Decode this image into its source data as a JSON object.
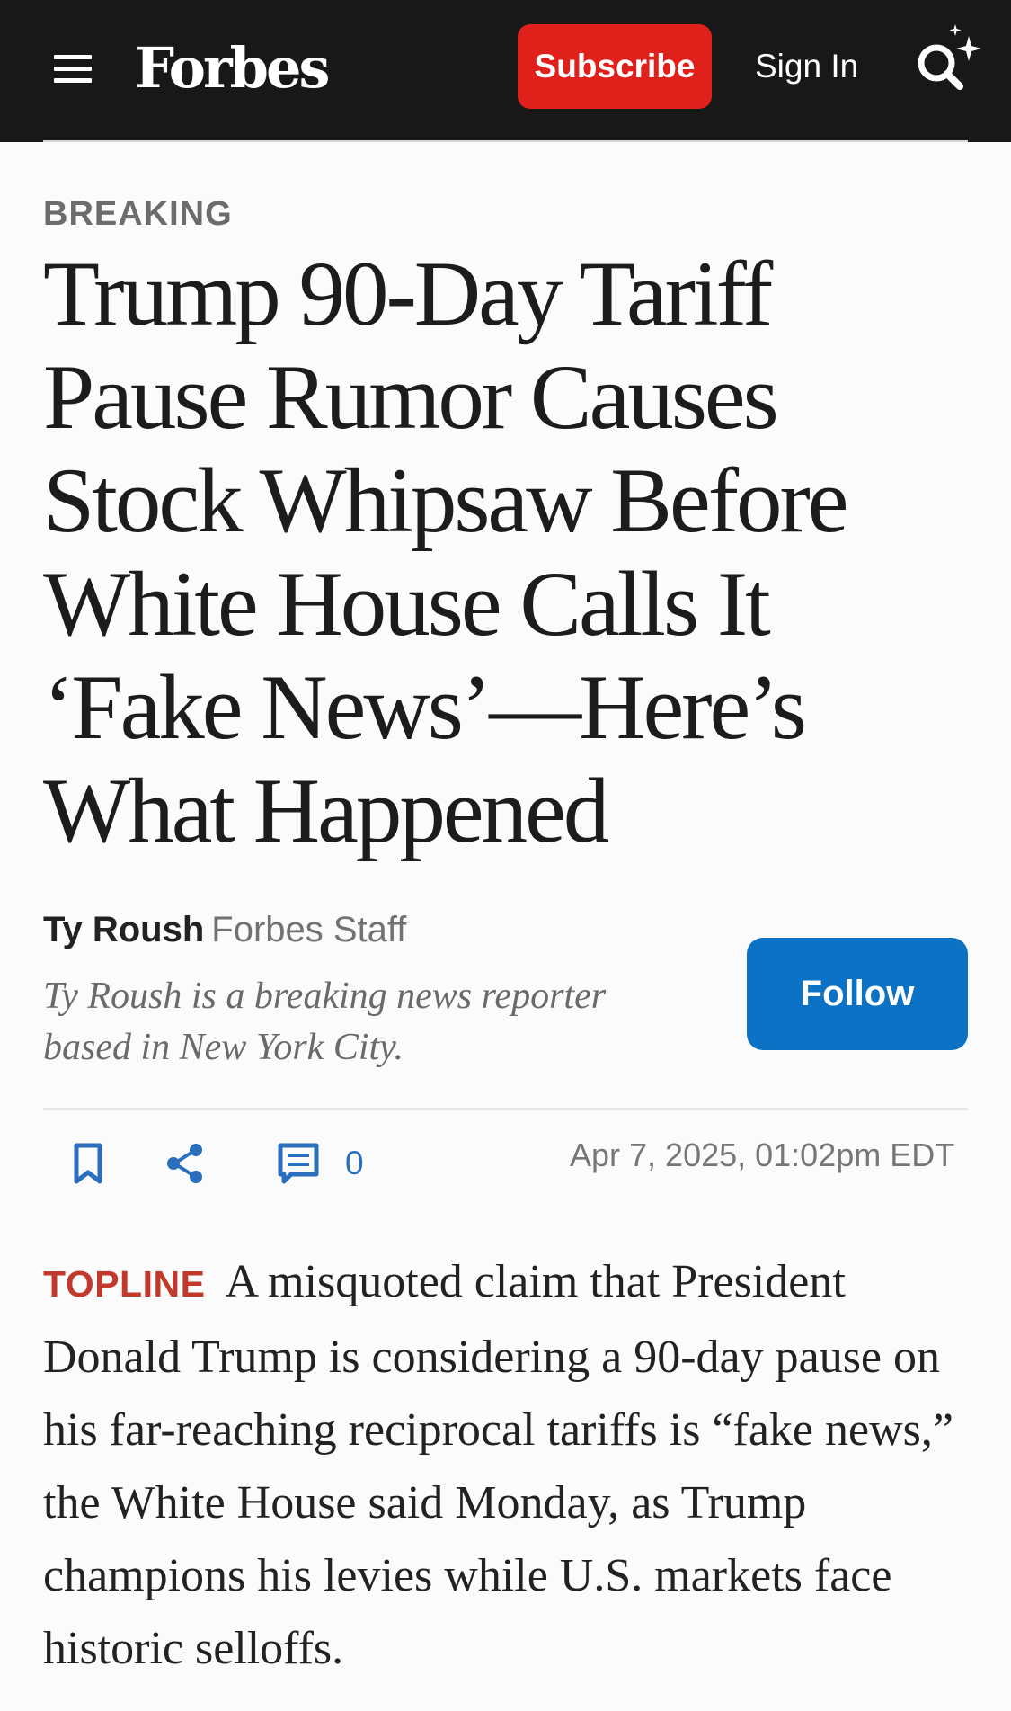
{
  "header": {
    "logo": "Forbes",
    "subscribe_label": "Subscribe",
    "signin_label": "Sign In",
    "icons": {
      "menu": "hamburger-menu-icon",
      "search": "ai-search-sparkle-icon"
    },
    "colors": {
      "background": "#181818",
      "subscribe": "#e0201a"
    }
  },
  "article": {
    "kicker": "BREAKING",
    "headline": "Trump 90-Day Tariff Pause Rumor Causes Stock Whipsaw Before White House Calls It ‘Fake News’—Here’s What Happened",
    "author": {
      "name": "Ty Roush",
      "role": "Forbes Staff",
      "bio": "Ty Roush is a breaking news reporter based in New York City.",
      "follow_label": "Follow",
      "follow_color": "#0b72c5"
    },
    "actions": {
      "bookmark_icon": "bookmark-icon",
      "share_icon": "share-icon",
      "comment_icon": "comment-icon",
      "comment_count": "0",
      "icon_color": "#2a6ebd"
    },
    "timestamp": "Apr 7, 2025,  01:02pm EDT",
    "topline": {
      "label": "TOPLINE",
      "label_color": "#c0392b",
      "text": "A misquoted claim that President Donald Trump is considering a 90-day pause on his far-reaching reciprocal tariffs is “fake news,” the White House said Monday, as Trump champions his levies while U.S. markets face historic selloffs."
    }
  }
}
